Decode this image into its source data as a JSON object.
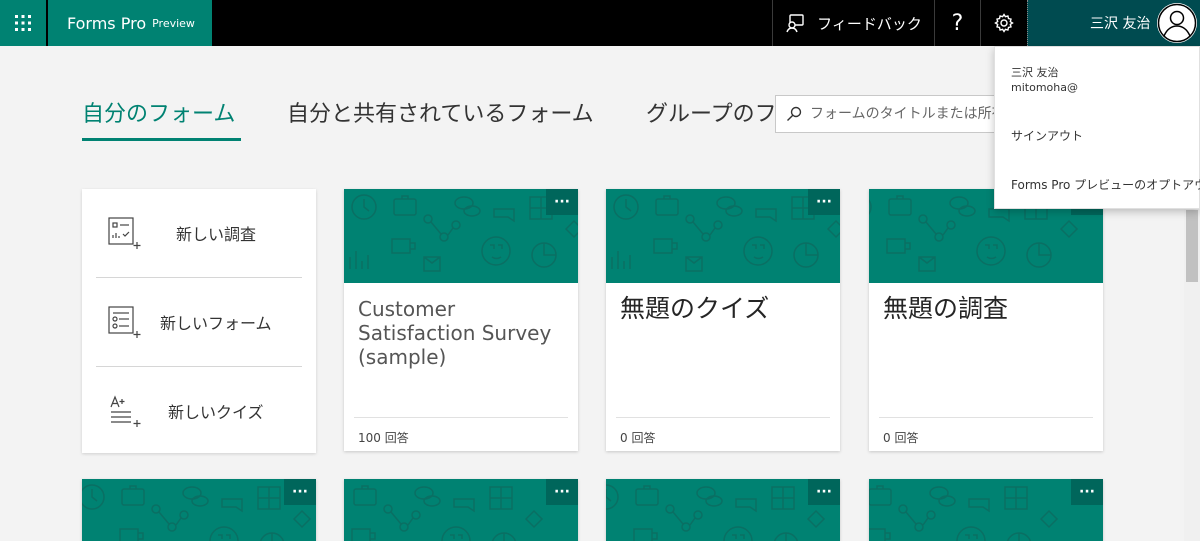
{
  "header": {
    "brand_name": "Forms Pro",
    "brand_tag": "Preview",
    "feedback_label": "フィードバック",
    "help_label": "?",
    "user_name": "三沢 友治"
  },
  "tabs": [
    {
      "label": "自分のフォーム",
      "selected": true
    },
    {
      "label": "自分と共有されているフォーム"
    },
    {
      "label": "グループのフォーム"
    }
  ],
  "search": {
    "placeholder": "フォームのタイトルまたは所有者で検索"
  },
  "new_items": [
    {
      "label": "新しい調査",
      "icon": "new-survey-icon"
    },
    {
      "label": "新しいフォーム",
      "icon": "new-form-icon"
    },
    {
      "label": "新しいクイズ",
      "icon": "new-quiz-icon"
    }
  ],
  "cards": [
    {
      "title": "Customer Satisfaction Survey (sample)",
      "responses": "100 回答"
    },
    {
      "title": "無題のクイズ",
      "responses": "0 回答"
    },
    {
      "title": "無題の調査",
      "responses": "0 回答"
    }
  ],
  "more_label": "···",
  "user_menu": {
    "name": "三沢 友治",
    "email": "mitomoha@",
    "sign_out": "サインアウト",
    "opt_out": "Forms Pro プレビューのオプトアウト"
  },
  "colors": {
    "accent": "#008272",
    "accent_dark": "#004b50",
    "header_bg": "#000000",
    "page_bg": "#f3f3f3"
  }
}
